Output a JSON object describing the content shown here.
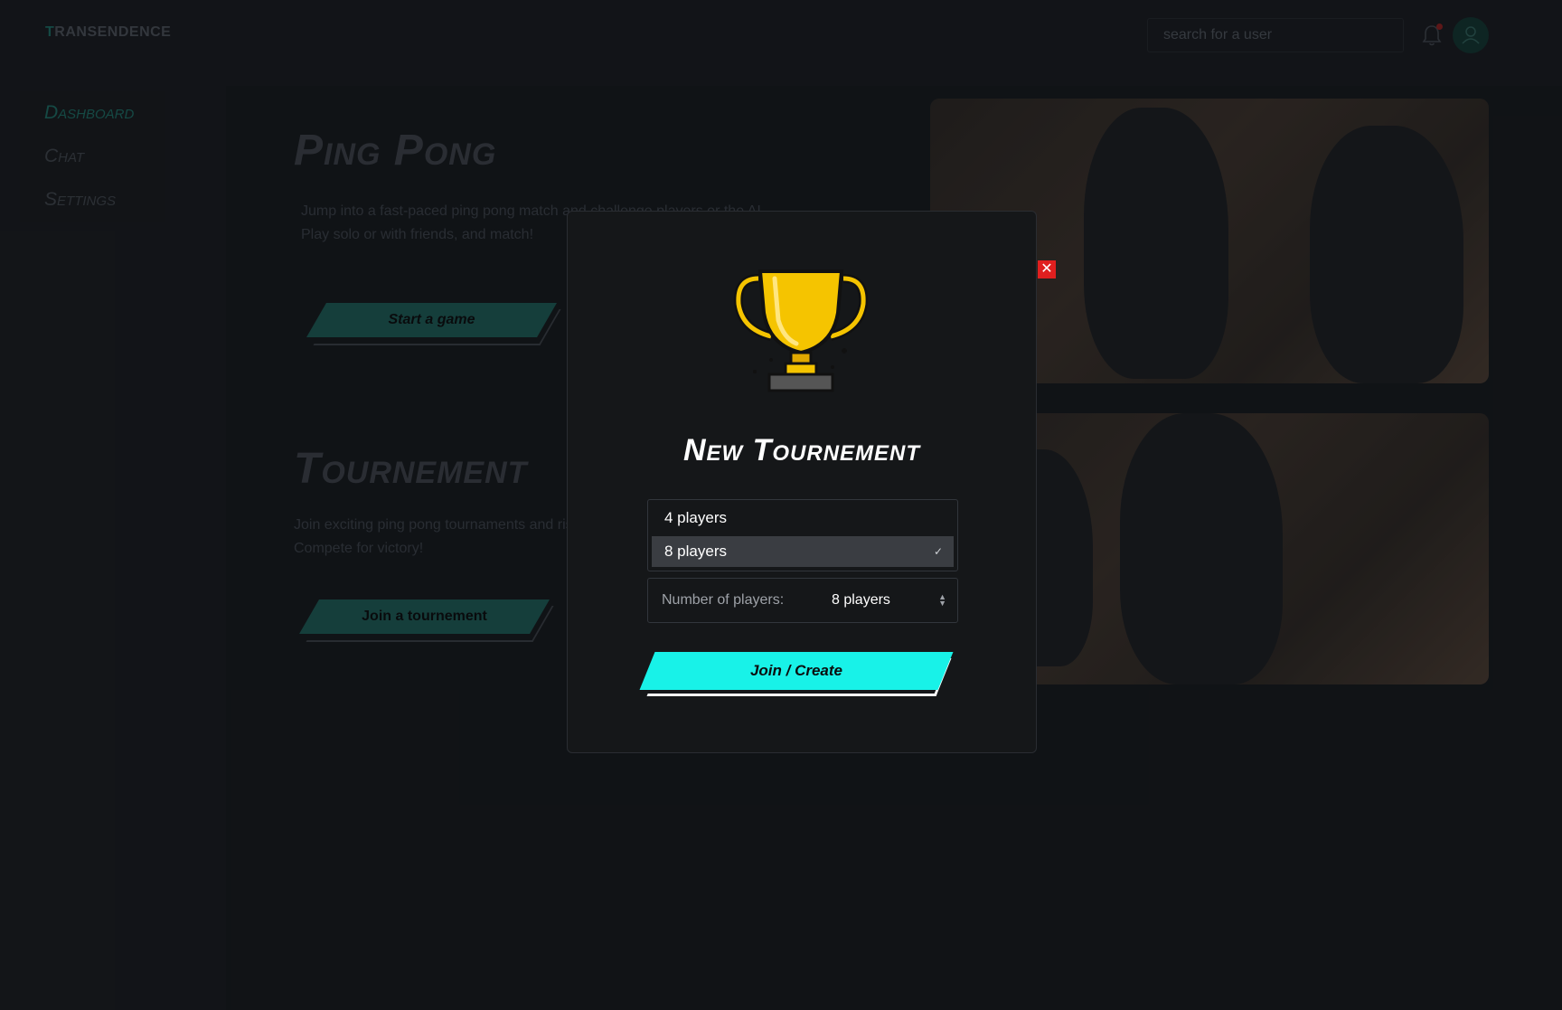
{
  "app": {
    "logo_first": "T",
    "logo_rest": "RANSENDENCE"
  },
  "header": {
    "search_placeholder": "search for a user"
  },
  "sidebar": {
    "items": [
      {
        "label": "Dashboard",
        "active": true
      },
      {
        "label": "Chat",
        "active": false
      },
      {
        "label": "Settings",
        "active": false
      }
    ]
  },
  "main": {
    "ping_pong": {
      "title": "Ping Pong",
      "description": "Jump into a fast-paced ping pong match and challenge players or the AI. Play solo or with friends, and match!",
      "button": "Start a game"
    },
    "tournement": {
      "title": "Tournement",
      "description": "Join exciting ping pong tournaments and rise up the leaderboard. Compete for victory!",
      "button": "Join a tournement"
    }
  },
  "modal": {
    "title": "New Tournement",
    "options": [
      {
        "label": "4 players",
        "selected": false
      },
      {
        "label": "8 players",
        "selected": true
      }
    ],
    "check_mark": "✓",
    "select_label": "Number of players:",
    "select_value": "8 players",
    "join_button": "Join / Create",
    "close_glyph": "✕"
  },
  "colors": {
    "accent": "#18f2e8",
    "teal": "#1d5953",
    "close": "#e01f1f",
    "trophy": "#f5c400"
  },
  "icons": {
    "bell": "bell-icon",
    "avatar": "user-icon",
    "trophy": "trophy-icon",
    "close": "close-icon"
  }
}
